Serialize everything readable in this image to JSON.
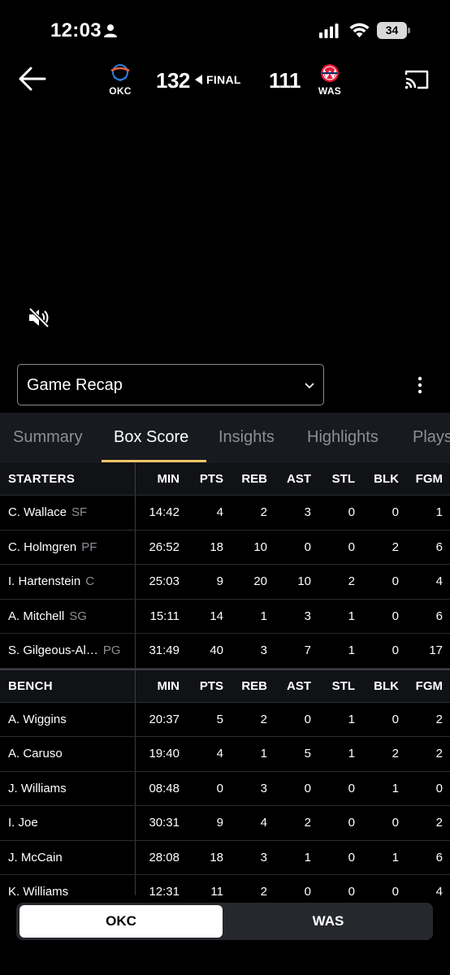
{
  "status_bar": {
    "time": "12:03",
    "battery": "34",
    "icons": [
      "person-icon",
      "signal-icon",
      "wifi-icon",
      "battery-icon"
    ]
  },
  "header": {
    "home_team": {
      "abbr": "OKC",
      "score": "132"
    },
    "away_team": {
      "abbr": "WAS",
      "score": "111"
    },
    "status": "FINAL",
    "icons": [
      "back-arrow-icon",
      "cast-icon",
      "mute-icon"
    ]
  },
  "video_selector": {
    "label": "Game Recap"
  },
  "tabs": [
    {
      "label": "Summary",
      "active": false
    },
    {
      "label": "Box Score",
      "active": true
    },
    {
      "label": "Insights",
      "active": false
    },
    {
      "label": "Highlights",
      "active": false
    },
    {
      "label": "Plays",
      "active": false
    }
  ],
  "box_score": {
    "columns": [
      "MIN",
      "PTS",
      "REB",
      "AST",
      "STL",
      "BLK",
      "FGM"
    ],
    "starters_label": "STARTERS",
    "bench_label": "BENCH",
    "starters": [
      {
        "name": "C. Wallace",
        "pos": "SF",
        "stats": [
          "14:42",
          "4",
          "2",
          "3",
          "0",
          "0",
          "1"
        ]
      },
      {
        "name": "C. Holmgren",
        "pos": "PF",
        "stats": [
          "26:52",
          "18",
          "10",
          "0",
          "0",
          "2",
          "6"
        ]
      },
      {
        "name": "I. Hartenstein",
        "pos": "C",
        "stats": [
          "25:03",
          "9",
          "20",
          "10",
          "2",
          "0",
          "4"
        ]
      },
      {
        "name": "A. Mitchell",
        "pos": "SG",
        "stats": [
          "15:11",
          "14",
          "1",
          "3",
          "1",
          "0",
          "6"
        ]
      },
      {
        "name": "S. Gilgeous-Al…",
        "pos": "PG",
        "stats": [
          "31:49",
          "40",
          "3",
          "7",
          "1",
          "0",
          "17"
        ]
      }
    ],
    "bench": [
      {
        "name": "A. Wiggins",
        "pos": "",
        "stats": [
          "20:37",
          "5",
          "2",
          "0",
          "1",
          "0",
          "2"
        ]
      },
      {
        "name": "A. Caruso",
        "pos": "",
        "stats": [
          "19:40",
          "4",
          "1",
          "5",
          "1",
          "2",
          "2"
        ]
      },
      {
        "name": "J. Williams",
        "pos": "",
        "stats": [
          "08:48",
          "0",
          "3",
          "0",
          "0",
          "1",
          "0"
        ]
      },
      {
        "name": "I. Joe",
        "pos": "",
        "stats": [
          "30:31",
          "9",
          "4",
          "2",
          "0",
          "0",
          "2"
        ]
      },
      {
        "name": "J. McCain",
        "pos": "",
        "stats": [
          "28:08",
          "18",
          "3",
          "1",
          "0",
          "1",
          "6"
        ]
      },
      {
        "name": "K. Williams",
        "pos": "",
        "stats": [
          "12:31",
          "11",
          "2",
          "0",
          "0",
          "0",
          "4"
        ]
      }
    ]
  },
  "team_toggle": {
    "selected": "OKC",
    "options": [
      "OKC",
      "WAS"
    ]
  },
  "colors": {
    "accent": "#f0c565",
    "background": "#000000",
    "tab_bar": "#181a1f",
    "muted_text": "#8b8f97"
  }
}
